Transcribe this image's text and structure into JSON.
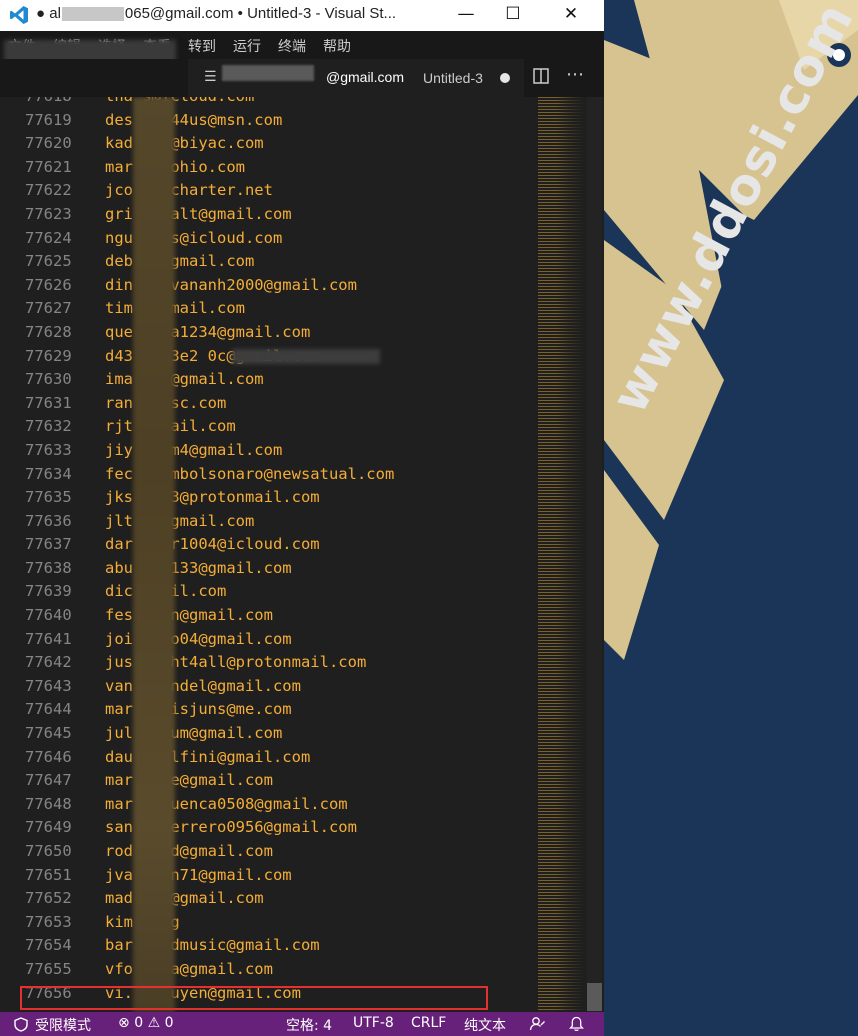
{
  "window": {
    "title_prefix": "● al",
    "title_suffix": "065@gmail.com • Untitled-3 - Visual St...",
    "min_glyph": "—",
    "max_glyph": "☐",
    "close_glyph": "✕"
  },
  "menu": [
    "文件",
    "编辑",
    "选择",
    "查看",
    "转到",
    "运行",
    "终端",
    "帮助"
  ],
  "tab": {
    "label_suffix": "@gmail.com",
    "file_name": "Untitled-3"
  },
  "editor": {
    "lines": [
      {
        "n": "77618",
        "text": "tha     s@icloud.com"
      },
      {
        "n": "77619",
        "text": "des     ose44us@msn.com"
      },
      {
        "n": "77620",
        "text": "kad     kka@biyac.com"
      },
      {
        "n": "77621",
        "text": "mar     rk4ohio.com"
      },
      {
        "n": "77622",
        "text": "jco     72@charter.net"
      },
      {
        "n": "77623",
        "text": "gri     n.walt@gmail.com"
      },
      {
        "n": "77624",
        "text": "ngu     01us@icloud.com"
      },
      {
        "n": "77625",
        "text": "deb     in@gmail.com"
      },
      {
        "n": "77626",
        "text": "din     yenvananh2000@gmail.com"
      },
      {
        "n": "77627",
        "text": "tim     9@gmail.com"
      },
      {
        "n": "77628",
        "text": "que     orta1234@gmail.com"
      },
      {
        "n": "77629",
        "text": "d43     f323e2                 0c@gmail.com",
        "mask": true
      },
      {
        "n": "77630",
        "text": "ima     763@gmail.com"
      },
      {
        "n": "77631",
        "text": "ran     odasc.com"
      },
      {
        "n": "77632",
        "text": "rjt     @gmail.com"
      },
      {
        "n": "77633",
        "text": "jiy     leem4@gmail.com"
      },
      {
        "n": "77634",
        "text": "fec     scombolsonaro@newsatual.com"
      },
      {
        "n": "77635",
        "text": "jks     erd3@protonmail.com"
      },
      {
        "n": "77636",
        "text": "jlt     la@gmail.com"
      },
      {
        "n": "77637",
        "text": "dar     aper1004@icloud.com"
      },
      {
        "n": "77638",
        "text": "abu     d21133@gmail.com"
      },
      {
        "n": "77639",
        "text": "dic     gmail.com"
      },
      {
        "n": "77640",
        "text": "fes     rson@gmail.com"
      },
      {
        "n": "77641",
        "text": "joi     piro04@gmail.com"
      },
      {
        "n": "77642",
        "text": "jus     ought4all@protonmail.com"
      },
      {
        "n": "77643",
        "text": "van     .wendel@gmail.com"
      },
      {
        "n": "77644",
        "text": "mar     j.misjuns@me.com"
      },
      {
        "n": "77645",
        "text": "jul     .brum@gmail.com"
      },
      {
        "n": "77646",
        "text": "dau     edelfini@gmail.com"
      },
      {
        "n": "77647",
        "text": "mar     vane@gmail.com"
      },
      {
        "n": "77648",
        "text": "mar     nocuenca0508@gmail.com"
      },
      {
        "n": "77649",
        "text": "san     oguerrero0956@gmail.com"
      },
      {
        "n": "77650",
        "text": "rod     .lud@gmail.com"
      },
      {
        "n": "77651",
        "text": "jva     veln71@gmail.com"
      },
      {
        "n": "77652",
        "text": "mad     705@gmail.com"
      },
      {
        "n": "77653",
        "text": "kim     t.kg"
      },
      {
        "n": "77654",
        "text": "bar     orldmusic@gmail.com"
      },
      {
        "n": "77655",
        "text": "vfo     rola@gmail.com"
      },
      {
        "n": "77656",
        "text": "vi.     xnguyen@gmail.com"
      }
    ]
  },
  "status": {
    "restricted": "受限模式",
    "errors": "0",
    "warnings": "0",
    "spaces": "空格: 4",
    "encoding": "UTF-8",
    "eol": "CRLF",
    "language": "纯文本"
  },
  "watermark": "www.ddosi.com",
  "colors": {
    "editor_bg": "#1f1f1f",
    "email_text": "#f4ad36",
    "line_number": "#858585",
    "status_bar": "#68217a",
    "highlight_box": "#e53030",
    "banner_bg": "#1a3557",
    "banner_logo": "#d7c38f"
  }
}
